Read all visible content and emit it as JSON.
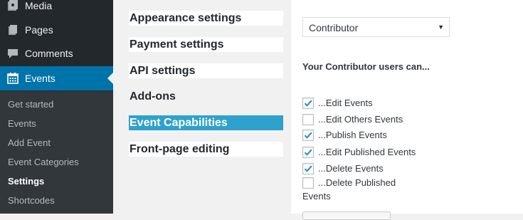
{
  "sidebar": {
    "menu": [
      {
        "label": "Media",
        "icon": "media-icon"
      },
      {
        "label": "Pages",
        "icon": "pages-icon"
      },
      {
        "label": "Comments",
        "icon": "comments-icon"
      },
      {
        "label": "Events",
        "icon": "calendar-icon",
        "current": true
      }
    ],
    "submenu": [
      {
        "label": "Get started"
      },
      {
        "label": "Events"
      },
      {
        "label": "Add Event"
      },
      {
        "label": "Event Categories"
      },
      {
        "label": "Settings",
        "current": true
      },
      {
        "label": "Shortcodes"
      }
    ]
  },
  "settings_nav": [
    {
      "label": "Appearance settings"
    },
    {
      "label": "Payment settings"
    },
    {
      "label": "API settings"
    },
    {
      "label": "Add-ons"
    },
    {
      "label": "Event Capabilities",
      "active": true
    },
    {
      "label": "Front-page editing"
    }
  ],
  "capabilities": {
    "role_select_value": "Contributor",
    "heading": "Your Contributor users can...",
    "items": [
      {
        "label": "...Edit Events",
        "checked": true
      },
      {
        "label": "...Edit Others Events",
        "checked": false
      },
      {
        "label": "...Publish Events",
        "checked": true
      },
      {
        "label": "...Edit Published Events",
        "checked": true
      },
      {
        "label": "...Delete Events",
        "checked": true
      },
      {
        "label": "...Delete Published",
        "checked": false
      }
    ],
    "last_item_wrap": "Events"
  },
  "colors": {
    "sidebar_bg": "#23282d",
    "submenu_bg": "#32373c",
    "accent": "#0073aa",
    "active_tab": "#2ea2cc",
    "checkmark": "#1e8cbe"
  }
}
